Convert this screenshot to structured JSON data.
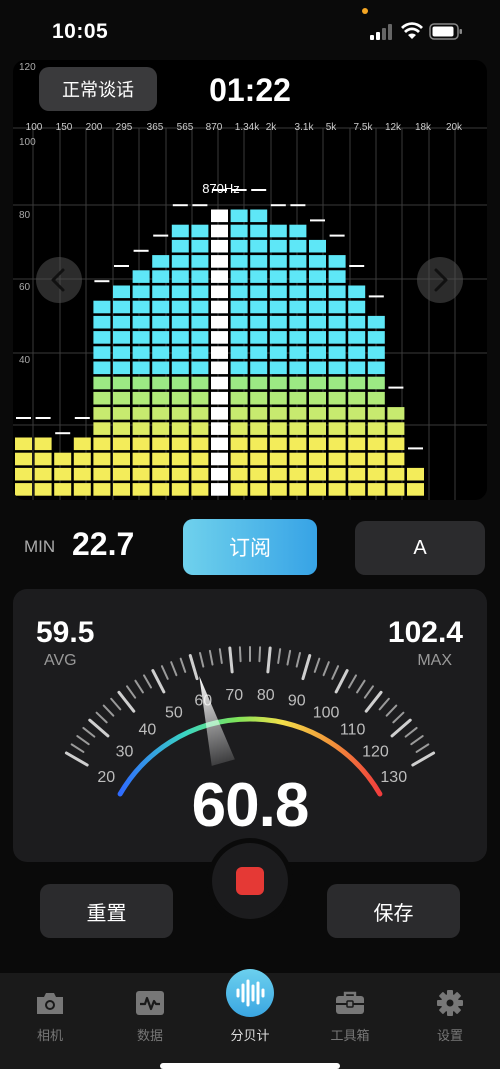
{
  "status_bar": {
    "time": "10:05"
  },
  "spectrum": {
    "mode_label": "正常谈话",
    "timer": "01:22",
    "peak_label": "870Hz",
    "y_ticks": [
      "120",
      "100",
      "80",
      "60",
      "40"
    ],
    "freq_labels": [
      "100",
      "150",
      "200",
      "295",
      "365",
      "565",
      "870",
      "1.34k",
      "2k",
      "3.1k",
      "5k",
      "7.5k",
      "12k",
      "18k",
      "20k"
    ],
    "band_levels": [
      4,
      4,
      3,
      4,
      13,
      14,
      15,
      16,
      18,
      18,
      19,
      19,
      19,
      18,
      18,
      17,
      16,
      14,
      12,
      6,
      2,
      0
    ],
    "peak_heights_px": [],
    "colors": {
      "cyan": "#5ee7f7",
      "green": "#86e88e",
      "yellow": "#f3ec5a",
      "peak_bar": "#ffffff"
    }
  },
  "summary": {
    "min_label": "MIN",
    "min_value": "22.7",
    "subscribe_label": "订阅",
    "weighting_label": "A"
  },
  "meter": {
    "avg_value": "59.5",
    "avg_label": "AVG",
    "max_value": "102.4",
    "max_label": "MAX",
    "current_value": "60.8",
    "scale_labels": [
      "20",
      "30",
      "40",
      "50",
      "60",
      "70",
      "80",
      "90",
      "100",
      "110",
      "120",
      "130"
    ],
    "needle_db": 60.8,
    "range_db": [
      20,
      130
    ]
  },
  "controls": {
    "reset_label": "重置",
    "save_label": "保存"
  },
  "tabs": [
    {
      "label": "相机",
      "icon": "camera-icon"
    },
    {
      "label": "数据",
      "icon": "pulse-chart-icon"
    },
    {
      "label": "分贝计",
      "icon": "sound-wave-icon",
      "active": true
    },
    {
      "label": "工具箱",
      "icon": "toolbox-icon"
    },
    {
      "label": "设置",
      "icon": "gear-icon"
    }
  ]
}
